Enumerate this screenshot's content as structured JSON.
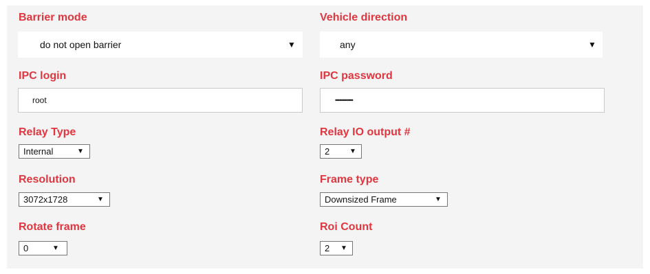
{
  "form": {
    "barrier_mode": {
      "label": "Barrier mode",
      "value": "do not open barrier"
    },
    "vehicle_direction": {
      "label": "Vehicle direction",
      "value": "any"
    },
    "ipc_login": {
      "label": "IPC login",
      "value": "root"
    },
    "ipc_password": {
      "label": "IPC password",
      "value": "••••••••••••"
    },
    "relay_type": {
      "label": "Relay Type",
      "value": "Internal"
    },
    "relay_io_output": {
      "label": "Relay IO output #",
      "value": "2"
    },
    "resolution": {
      "label": "Resolution",
      "value": "3072x1728"
    },
    "frame_type": {
      "label": "Frame type",
      "value": "Downsized Frame"
    },
    "rotate_frame": {
      "label": "Rotate frame",
      "value": "0"
    },
    "roi_count": {
      "label": "Roi Count",
      "value": "2"
    }
  },
  "icons": {
    "dropdown_arrow": "▼"
  },
  "colors": {
    "label": "#e0363f",
    "panel_background": "#f4f4f4"
  }
}
